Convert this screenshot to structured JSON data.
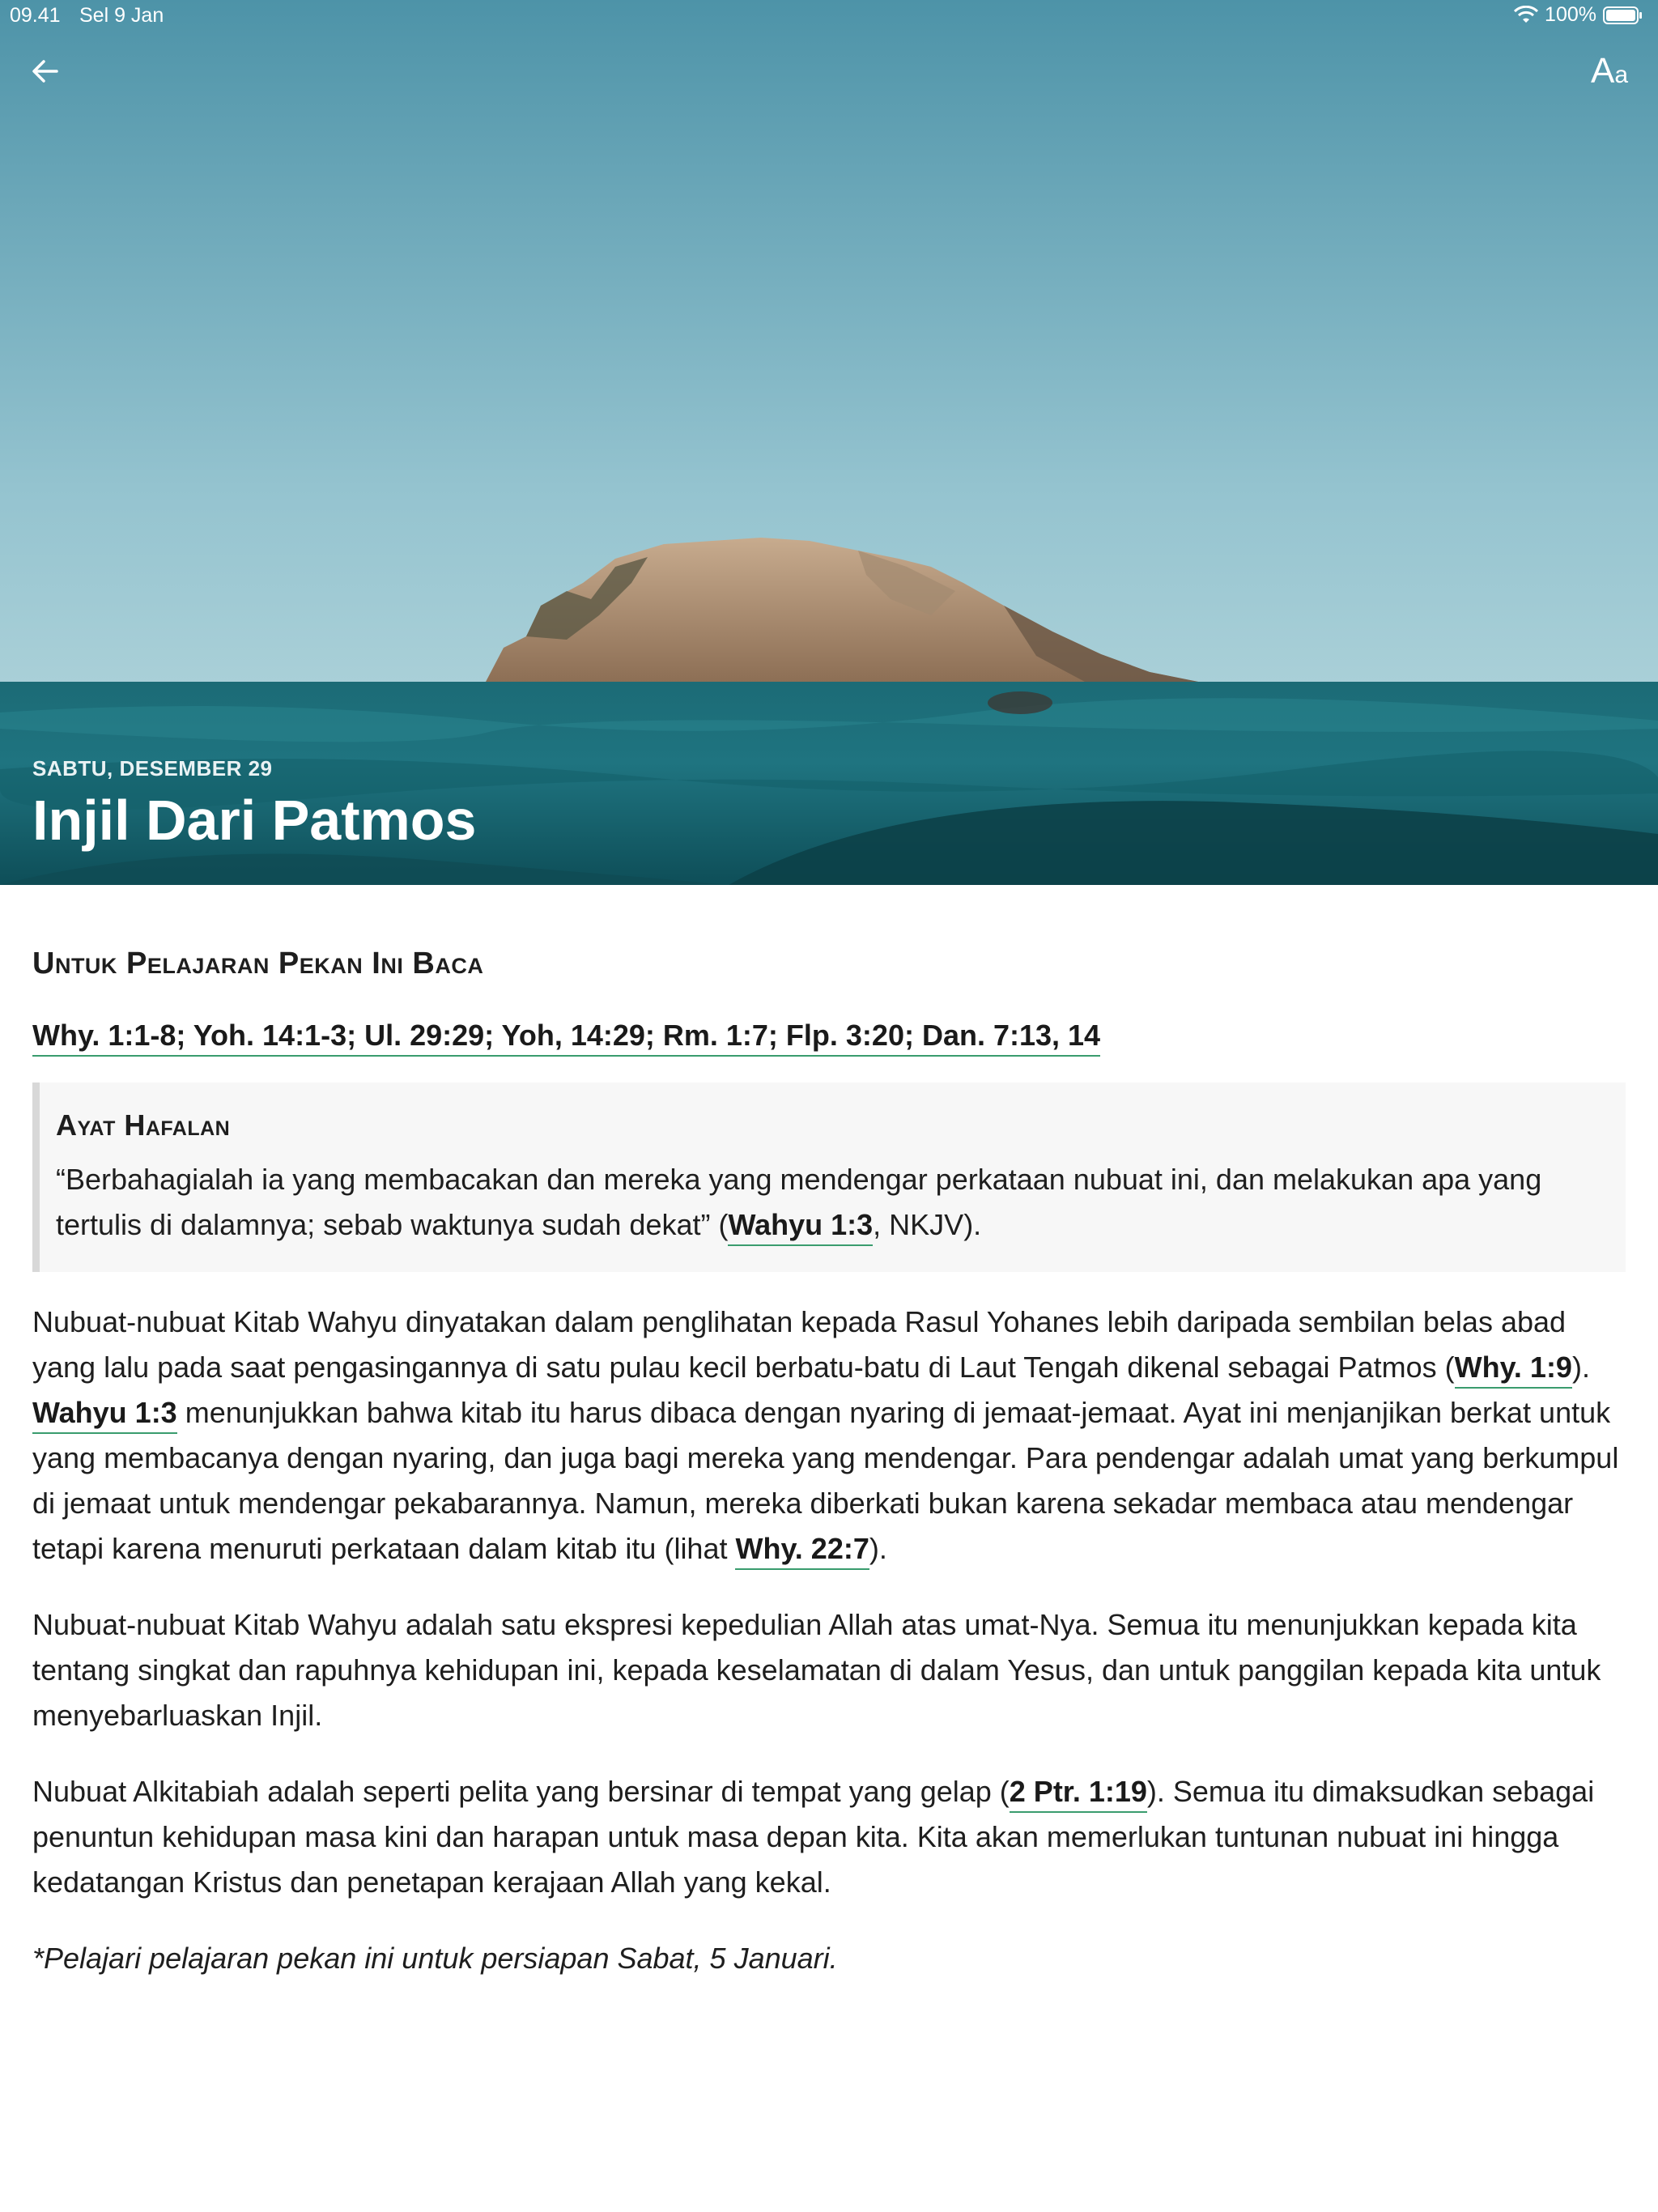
{
  "status_bar": {
    "time": "09.41",
    "date": "Sel 9 Jan",
    "battery": "100%"
  },
  "header": {
    "back_icon": "arrow-left-icon",
    "font_button_big": "A",
    "font_button_small": "a",
    "date": "SABTU, DESEMBER 29",
    "title": "Injil Dari Patmos"
  },
  "reading": {
    "heading": "Untuk Pelajaran Pekan Ini Baca",
    "references": "Why. 1:1-8; Yoh. 14:1-3; Ul. 29:29; Yoh, 14:29; Rm. 1:7; Flp. 3:20; Dan. 7:13, 14"
  },
  "memory_verse": {
    "title": "Ayat Hafalan",
    "text_before": "“Berbahagialah ia yang membacakan dan mereka yang mendengar perkataan nubuat ini, dan melakukan apa yang tertulis di dalamnya; sebab waktunya sudah dekat” (",
    "ref": "Wahyu 1:3",
    "text_after": ", NKJV)."
  },
  "paragraphs": {
    "p1": {
      "part1": "Nubuat-nubuat Kitab Wahyu dinyatakan dalam penglihatan kepada Rasul Yohanes lebih daripada sembilan belas abad yang lalu pada saat pengasingannya di satu pulau kecil berbatu-batu di Laut Tengah dikenal sebagai Patmos (",
      "ref1": "Why. 1:9",
      "part2": "). ",
      "ref2": "Wahyu 1:3",
      "part3": " menunjukkan bahwa kitab itu harus dibaca dengan nyaring di jemaat-jemaat. Ayat ini menjanjikan berkat untuk yang membacanya dengan nyaring, dan juga bagi mereka yang mendengar. Para pendengar adalah umat yang berkumpul di jemaat untuk mendengar pekabarannya. Namun, mereka diberkati bukan karena sekadar membaca atau mendengar tetapi karena menuruti perkataan dalam kitab itu (lihat ",
      "ref3": "Why. 22:7",
      "part4": ")."
    },
    "p2": "Nubuat-nubuat Kitab Wahyu adalah satu ekspresi kepedulian Allah atas umat-Nya. Semua itu menunjukkan kepada kita tentang singkat dan rapuhnya kehidupan ini, kepada keselamatan di dalam Yesus, dan untuk panggilan kepada kita untuk menyebarluaskan Injil.",
    "p3": {
      "part1": "Nubuat Alkitabiah adalah seperti pelita yang bersinar di tempat yang gelap (",
      "ref1": "2 Ptr. 1:19",
      "part2": "). Semua itu dimaksudkan sebagai penuntun kehidupan masa kini dan harapan untuk masa depan kita. Kita akan memerlukan tuntunan nubuat ini hingga kedatangan Kristus dan penetapan kerajaan Allah yang kekal."
    },
    "footnote": "*Pelajari pelajaran pekan ini untuk persiapan Sabat, 5 Januari."
  },
  "colors": {
    "link_underline": "#3a9c6e",
    "sea": "#1f6e78",
    "sky_top": "#4d93a8"
  }
}
